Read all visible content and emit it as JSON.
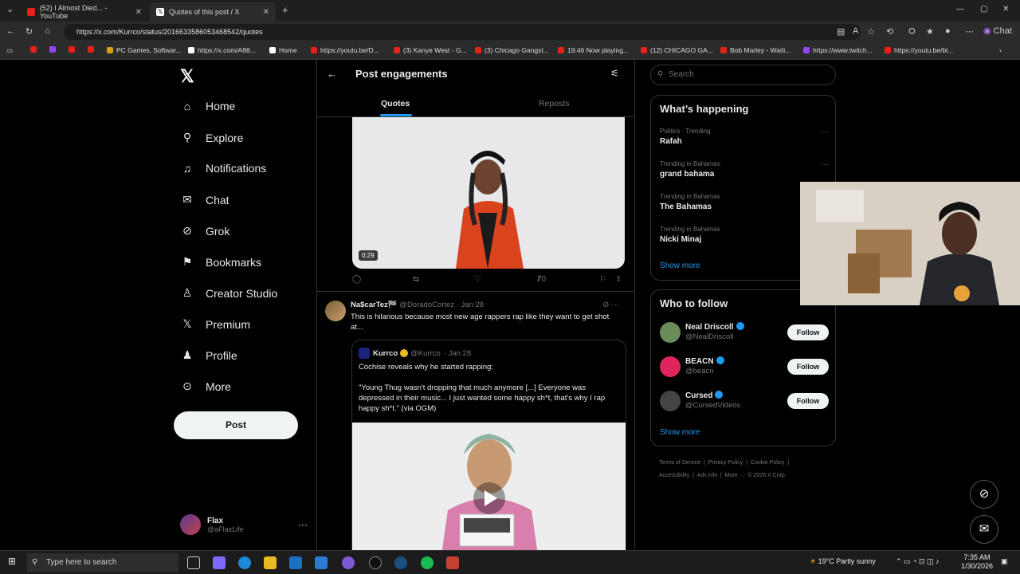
{
  "browser": {
    "tabs": [
      {
        "title": "(52) I Almost Died... - YouTube"
      },
      {
        "title": "Quotes of this post / X"
      }
    ],
    "new_tab": "+",
    "url": "https://x.com/Kurrco/status/2016633586053468542/quotes",
    "bookmarks": [
      "PC Games, Softwar...",
      "https://x.com/A88...",
      "Home",
      "https://youtu.be/D...",
      "(3) Kanye West - G...",
      "(3) Chicago Gangst...",
      "19:46 Now playing...",
      "(12) CHICAGO GA...",
      "Bob Marley - Waiti...",
      "https://www.twitch...",
      "https://youtu.be/bl..."
    ],
    "copilot_label": "Chat"
  },
  "nav": {
    "items": [
      {
        "label": "Home",
        "icon": "home-icon"
      },
      {
        "label": "Explore",
        "icon": "search-icon"
      },
      {
        "label": "Notifications",
        "icon": "bell-icon"
      },
      {
        "label": "Chat",
        "icon": "mail-icon"
      },
      {
        "label": "Grok",
        "icon": "grok-icon"
      },
      {
        "label": "Bookmarks",
        "icon": "bookmark-icon"
      },
      {
        "label": "Creator Studio",
        "icon": "creator-icon"
      },
      {
        "label": "Premium",
        "icon": "x-icon"
      },
      {
        "label": "Profile",
        "icon": "person-icon"
      },
      {
        "label": "More",
        "icon": "more-circle-icon"
      }
    ],
    "post_button": "Post",
    "account": {
      "name": "Flax",
      "handle": "@aFlaxLife"
    }
  },
  "main": {
    "title": "Post engagements",
    "tabs": [
      "Quotes",
      "Reposts"
    ],
    "video_duration": "0:29",
    "video_views": "70",
    "post": {
      "name": "Na$carTez🏁",
      "handle": "@DoradoCortez",
      "date": "· Jan 28",
      "text": "This is hilarious because most new age rappers rap like they want to get shot at...",
      "quote": {
        "name": "Kurrco",
        "handle": "@Kurrco",
        "date": "· Jan 28",
        "line1": "Cochise reveals why he started rapping:",
        "line2": "\"Young Thug wasn't dropping that much anymore [...] Everyone was depressed in their music... I just wanted some happy sh*t, that's why I rap happy sh*t.\" (via OGM)"
      }
    }
  },
  "sidebar": {
    "search_placeholder": "Search",
    "whats_happening": "What’s happening",
    "trends": [
      {
        "category": "Politics · Trending",
        "name": "Rafah"
      },
      {
        "category": "Trending in Bahamas",
        "name": "grand bahama"
      },
      {
        "category": "Trending in Bahamas",
        "name": "The Bahamas"
      },
      {
        "category": "Trending in Bahamas",
        "name": "Nicki Minaj"
      }
    ],
    "show_more": "Show more",
    "who_to_follow": "Who to follow",
    "follow": [
      {
        "name": "Neal Driscoll",
        "handle": "@NealDriscoll",
        "button": "Follow"
      },
      {
        "name": "BEACN",
        "handle": "@beacn",
        "button": "Follow"
      },
      {
        "name": "Cursed",
        "handle": "@CursedVideos",
        "button": "Follow"
      }
    ],
    "footer": [
      "Terms of Service",
      "|",
      "Privacy Policy",
      "|",
      "Cookie Policy",
      "|",
      "Accessibility",
      "|",
      "Ads info",
      "|",
      "More ···",
      "© 2026 X Corp."
    ]
  },
  "taskbar": {
    "search_placeholder": "Type here to search",
    "weather": "19°C  Partly sunny",
    "time": "7:35 AM",
    "date": "1/30/2026"
  },
  "colors": {
    "accent": "#1d9bf0",
    "verified": "#1d9bf0",
    "gold": "#e8b923"
  }
}
